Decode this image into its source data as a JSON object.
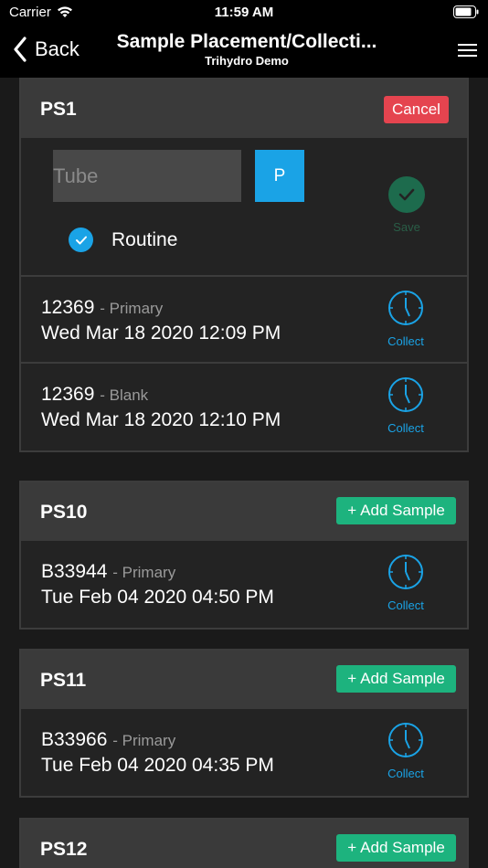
{
  "status_bar": {
    "carrier": "Carrier",
    "time": "11:59 AM"
  },
  "nav": {
    "back_label": "Back",
    "title": "Sample Placement/Collecti...",
    "subtitle": "Trihydro Demo"
  },
  "colors": {
    "accent_blue": "#1aa3e6",
    "add_green": "#1db37e",
    "cancel_red": "#e5444f"
  },
  "ps1": {
    "title": "PS1",
    "cancel_label": "Cancel",
    "tube_placeholder": "Tube",
    "p_label": "P",
    "routine_label": "Routine",
    "save_label": "Save",
    "samples": [
      {
        "id": "12369",
        "type": "- Primary",
        "date": "Wed Mar 18 2020 12:09 PM",
        "action": "Collect"
      },
      {
        "id": "12369",
        "type": "- Blank",
        "date": "Wed Mar 18 2020 12:10 PM",
        "action": "Collect"
      }
    ]
  },
  "ps10": {
    "title": "PS10",
    "add_label": "Add Sample",
    "samples": [
      {
        "id": "B33944",
        "type": "- Primary",
        "date": "Tue Feb 04 2020 04:50 PM",
        "action": "Collect"
      }
    ]
  },
  "ps11": {
    "title": "PS11",
    "add_label": "Add Sample",
    "samples": [
      {
        "id": "B33966",
        "type": "- Primary",
        "date": "Tue Feb 04 2020 04:35 PM",
        "action": "Collect"
      }
    ]
  },
  "ps12": {
    "title": "PS12",
    "add_label": "Add Sample"
  }
}
